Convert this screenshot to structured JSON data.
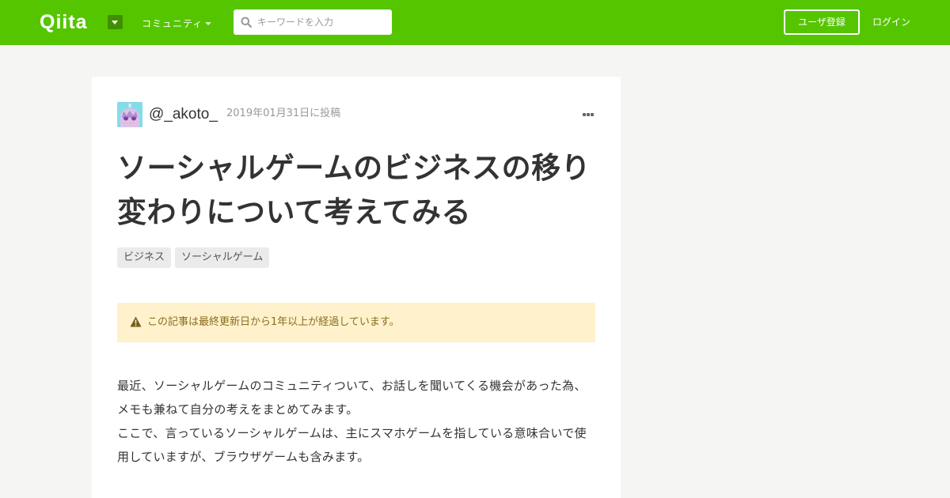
{
  "header": {
    "logo": "Qiita",
    "community_label": "コミュニティ",
    "search_placeholder": "キーワードを入力",
    "signup_label": "ユーザ登録",
    "login_label": "ログイン",
    "brand_color": "#55c500"
  },
  "article": {
    "author": "@_akoto_",
    "posted_date": "2019年01月31日に投稿",
    "title": "ソーシャルゲームのビジネスの移り変わりについて考えてみる",
    "tags": [
      "ビジネス",
      "ソーシャルゲーム"
    ],
    "notice": "この記事は最終更新日から1年以上が経過しています。",
    "paragraphs": [
      "最近、ソーシャルゲームのコミュニティついて、お話しを聞いてくる機会があった為、メモも兼ねて自分の考えをまとめてみます。",
      "ここで、言っているソーシャルゲームは、主にスマホゲームを指している意味合いで使用していますが、ブラウザゲームも含みます。"
    ]
  },
  "icons": {
    "search": "search-icon",
    "warning": "warning-icon",
    "more": "more-icon",
    "dropdown": "chevron-down-icon"
  }
}
